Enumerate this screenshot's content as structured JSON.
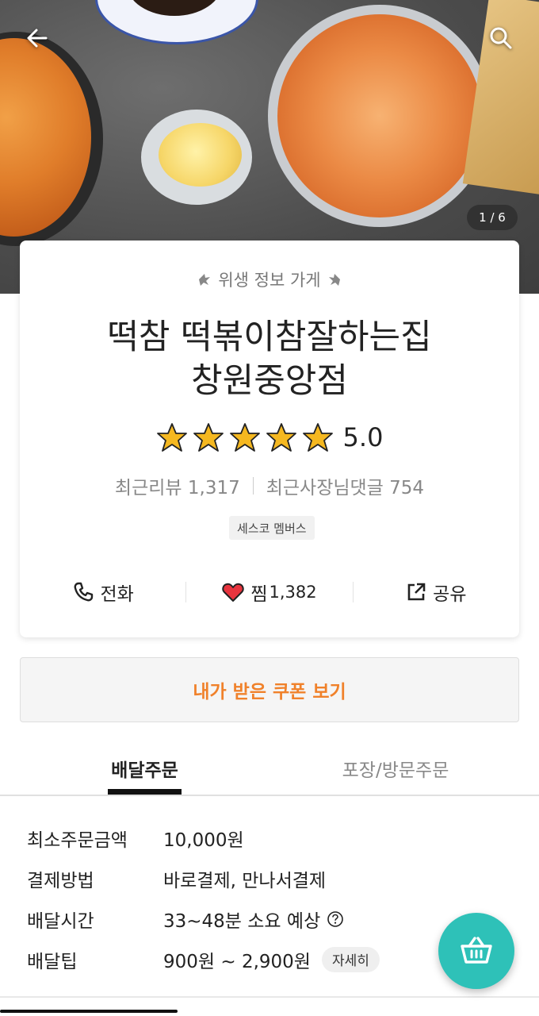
{
  "hero": {
    "pager": "1 / 6"
  },
  "store": {
    "hygiene_label": "위생 정보 가게",
    "name_line1": "떡참 떡볶이참잘하는집",
    "name_line2": "창원중앙점",
    "rating": "5.0",
    "stars": 5,
    "recent_reviews": "최근리뷰 1,317",
    "owner_replies": "최근사장님댓글 754",
    "badge": "세스코 멤버스"
  },
  "actions": {
    "call": "전화",
    "favorite": "찜",
    "favorite_count": "1,382",
    "share": "공유"
  },
  "coupon": {
    "label": "내가 받은 쿠폰 보기"
  },
  "tabs": {
    "delivery": "배달주문",
    "pickup": "포장/방문주문"
  },
  "info": {
    "min_order_label": "최소주문금액",
    "min_order_value": "10,000원",
    "payment_label": "결제방법",
    "payment_value": "바로결제, 만나서결제",
    "delivery_time_label": "배달시간",
    "delivery_time_value": "33~48분 소요 예상",
    "delivery_tip_label": "배달팁",
    "delivery_tip_value": "900원 ~ 2,900원",
    "detail_button": "자세히"
  },
  "colors": {
    "accent_orange": "#f0812a",
    "fab_teal": "#2ec1b8",
    "heart_red": "#e8343e",
    "star_gold": "#f5b820"
  }
}
